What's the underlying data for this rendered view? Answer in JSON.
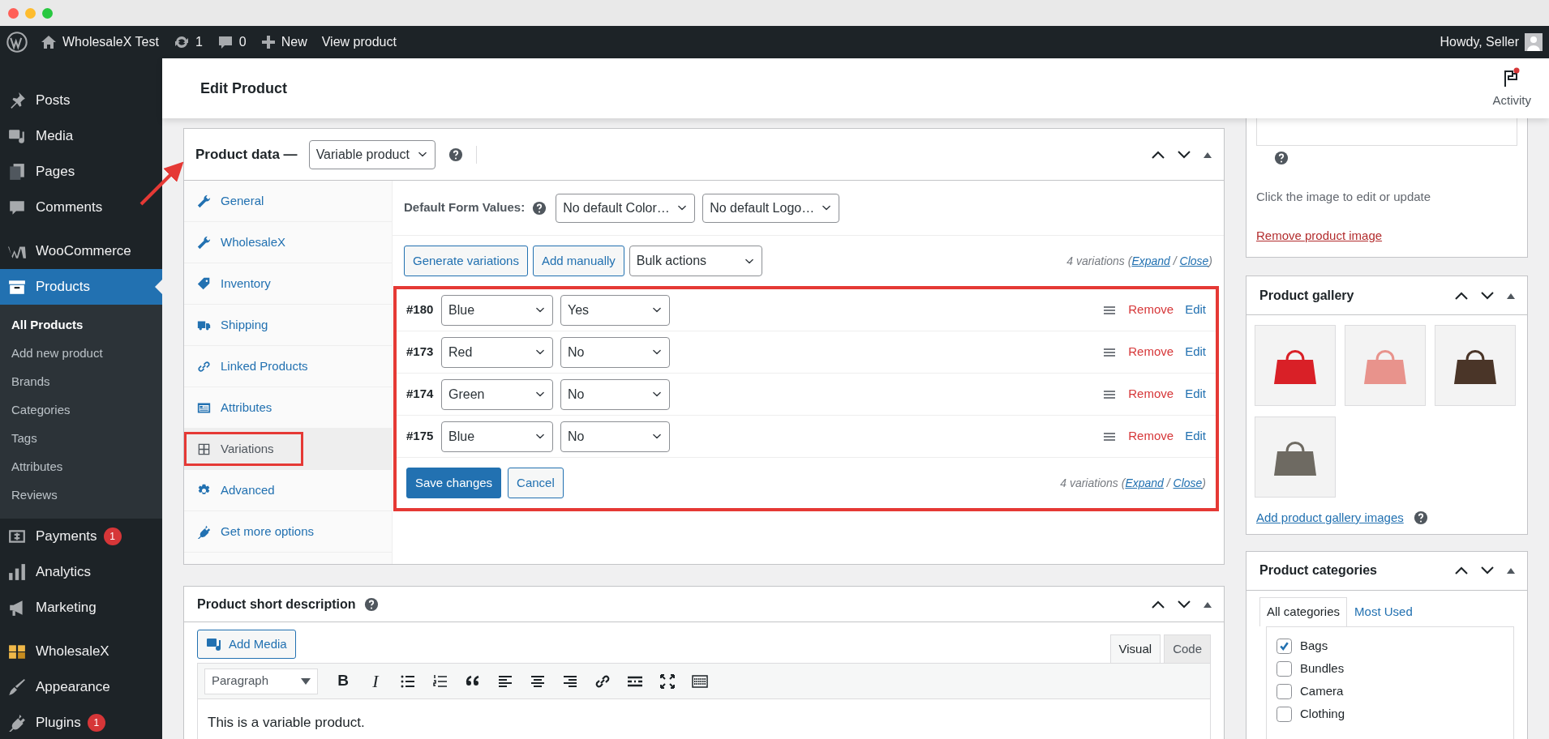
{
  "admin_bar": {
    "site": "WholesaleX Test",
    "updates": "1",
    "comments": "0",
    "new": "New",
    "view": "View product",
    "greeting": "Howdy, Seller"
  },
  "sidebar": {
    "groups": [
      [
        {
          "label": "Posts",
          "selected": false
        },
        {
          "label": "Media",
          "selected": false
        },
        {
          "label": "Pages",
          "selected": false
        },
        {
          "label": "Comments",
          "selected": false
        }
      ],
      [
        {
          "label": "WooCommerce",
          "selected": false
        },
        {
          "label": "Products",
          "selected": true,
          "children": [
            {
              "label": "All Products",
              "selected": true
            },
            {
              "label": "Add new product",
              "selected": false
            },
            {
              "label": "Brands",
              "selected": false
            },
            {
              "label": "Categories",
              "selected": false
            },
            {
              "label": "Tags",
              "selected": false
            },
            {
              "label": "Attributes",
              "selected": false
            },
            {
              "label": "Reviews",
              "selected": false
            }
          ]
        },
        {
          "label": "Payments",
          "selected": false,
          "badge": "1"
        },
        {
          "label": "Analytics",
          "selected": false
        },
        {
          "label": "Marketing",
          "selected": false
        }
      ],
      [
        {
          "label": "WholesaleX",
          "selected": false
        },
        {
          "label": "Appearance",
          "selected": false
        },
        {
          "label": "Plugins",
          "selected": false,
          "badge": "1"
        }
      ]
    ]
  },
  "header": {
    "title": "Edit Product",
    "activity": "Activity",
    "activity_unread": true
  },
  "product_data": {
    "title": "Product data —",
    "type": "Variable product",
    "tabs": [
      {
        "label": "General",
        "selected": false,
        "highlighted": false
      },
      {
        "label": "WholesaleX",
        "selected": false,
        "highlighted": false
      },
      {
        "label": "Inventory",
        "selected": false,
        "highlighted": false
      },
      {
        "label": "Shipping",
        "selected": false,
        "highlighted": false
      },
      {
        "label": "Linked Products",
        "selected": false,
        "highlighted": false
      },
      {
        "label": "Attributes",
        "selected": false,
        "highlighted": false
      },
      {
        "label": "Variations",
        "selected": true,
        "highlighted": true
      },
      {
        "label": "Advanced",
        "selected": false,
        "highlighted": false
      },
      {
        "label": "Get more options",
        "selected": false,
        "highlighted": false
      }
    ],
    "default_label": "Default Form Values:",
    "defaults": [
      "No default Color…",
      "No default Logo…"
    ],
    "actions": [
      "Generate variations",
      "Add manually"
    ],
    "bulk": "Bulk actions",
    "summary": [
      {
        "kind": "text",
        "text": "4 variations ("
      },
      {
        "kind": "link",
        "text": "Expand"
      },
      {
        "kind": "text",
        "text": " / "
      },
      {
        "kind": "link",
        "text": "Close"
      },
      {
        "kind": "text",
        "text": ")"
      }
    ],
    "variations_highlighted": true,
    "variations": [
      {
        "number": "#180",
        "options": [
          "Blue",
          "Yes"
        ],
        "remove": "Remove",
        "edit": "Edit"
      },
      {
        "number": "#173",
        "options": [
          "Red",
          "No"
        ],
        "remove": "Remove",
        "edit": "Edit"
      },
      {
        "number": "#174",
        "options": [
          "Green",
          "No"
        ],
        "remove": "Remove",
        "edit": "Edit"
      },
      {
        "number": "#175",
        "options": [
          "Blue",
          "No"
        ],
        "remove": "Remove",
        "edit": "Edit"
      }
    ],
    "save": "Save changes",
    "cancel": "Cancel",
    "footer_summary": [
      {
        "kind": "text",
        "text": "4 variations ("
      },
      {
        "kind": "link",
        "text": "Expand"
      },
      {
        "kind": "text",
        "text": " / "
      },
      {
        "kind": "link",
        "text": "Close"
      },
      {
        "kind": "text",
        "text": ")"
      }
    ]
  },
  "short_description": {
    "title": "Product short description",
    "add_media": "Add Media",
    "editor_tabs": [
      {
        "label": "Visual",
        "selected": true
      },
      {
        "label": "Code",
        "selected": false
      }
    ],
    "format": "Paragraph",
    "toolbar": [
      {
        "kind": "bold",
        "glyph": "B"
      },
      {
        "kind": "italic",
        "glyph": "I"
      },
      {
        "kind": "bullets"
      },
      {
        "kind": "numbers"
      },
      {
        "kind": "quote"
      },
      {
        "kind": "align-left"
      },
      {
        "kind": "align-center"
      },
      {
        "kind": "align-right"
      },
      {
        "kind": "link"
      },
      {
        "kind": "more"
      },
      {
        "kind": "fullscreen"
      },
      {
        "kind": "kitchen-sink"
      }
    ],
    "content": "This is a variable product."
  },
  "product_image": {
    "hint": "Click the image to edit or update",
    "remove": "Remove product image"
  },
  "gallery": {
    "title": "Product gallery",
    "images": [
      {
        "color": "#d92027"
      },
      {
        "color": "#e8938c"
      },
      {
        "color": "#4a3528"
      },
      {
        "color": "#6e6a62"
      }
    ],
    "add": "Add product gallery images"
  },
  "categories": {
    "title": "Product categories",
    "tabs": [
      {
        "label": "All categories",
        "selected": true
      },
      {
        "label": "Most Used",
        "selected": false
      }
    ],
    "items": [
      {
        "label": "Bags",
        "checked": true
      },
      {
        "label": "Bundles",
        "checked": false
      },
      {
        "label": "Camera",
        "checked": false
      },
      {
        "label": "Clothing",
        "checked": false
      }
    ]
  }
}
